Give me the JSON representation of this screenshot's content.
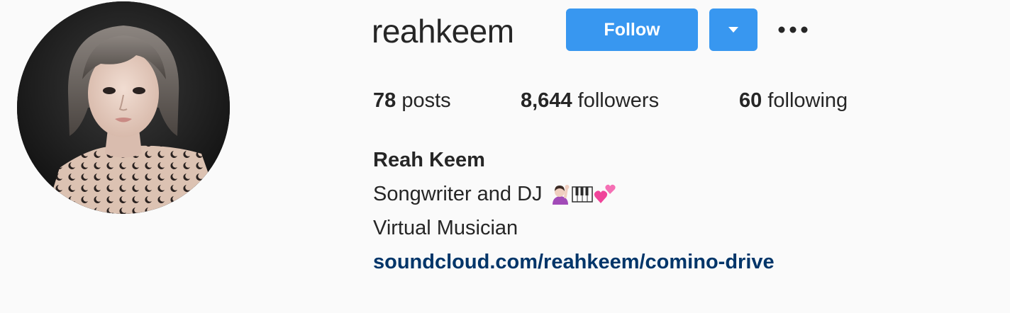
{
  "profile": {
    "username": "reahkeem",
    "full_name": "Reah Keem",
    "bio_line1": "Songwriter and DJ",
    "bio_line1_emojis": [
      "person-raising-hand-emoji",
      "piano-keys-emoji",
      "two-hearts-emoji"
    ],
    "bio_line2": "Virtual Musician",
    "website": "soundcloud.com/reahkeem/comino-drive"
  },
  "actions": {
    "follow_label": "Follow",
    "dropdown_icon": "caret-down-icon",
    "more_icon": "more-options-icon"
  },
  "stats": {
    "posts_count": "78",
    "posts_label": "posts",
    "followers_count": "8,644",
    "followers_label": "followers",
    "following_count": "60",
    "following_label": "following"
  },
  "colors": {
    "primary_button": "#3897f0",
    "link": "#003569",
    "text": "#262626",
    "background": "#fafafa"
  }
}
